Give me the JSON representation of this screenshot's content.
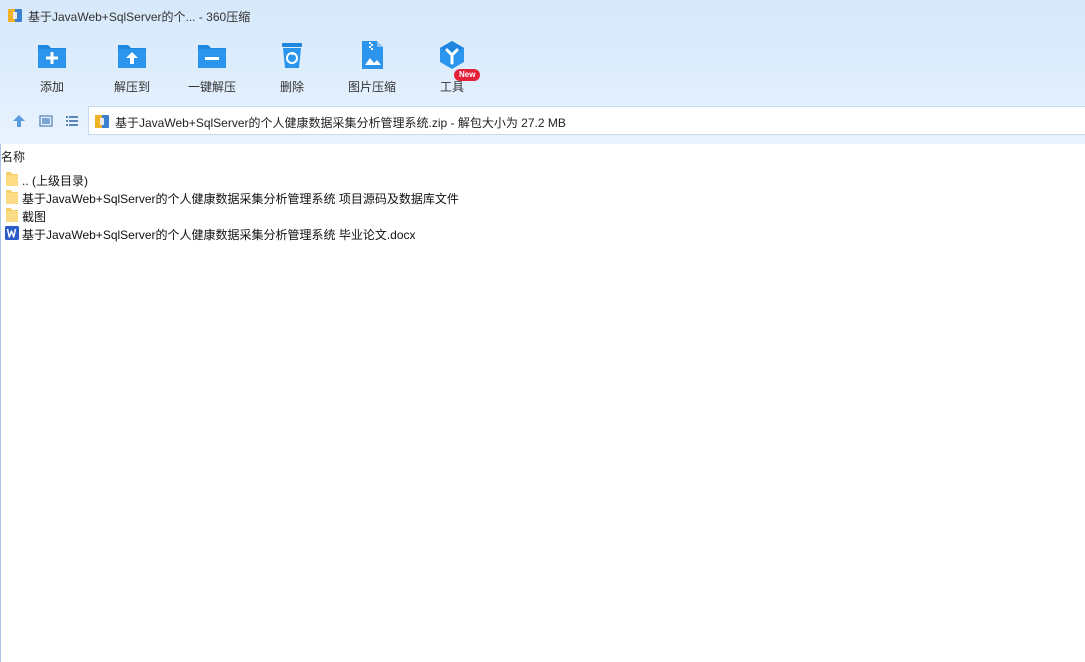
{
  "window": {
    "title": "基于JavaWeb+SqlServer的个... - 360压缩",
    "accent_color": "#2e8de4"
  },
  "toolbar": {
    "items": [
      {
        "label": "添加",
        "icon": "add-icon"
      },
      {
        "label": "解压到",
        "icon": "extract-to-icon"
      },
      {
        "label": "一键解压",
        "icon": "one-click-extract-icon"
      },
      {
        "label": "删除",
        "icon": "delete-icon"
      },
      {
        "label": "图片压缩",
        "icon": "image-compress-icon"
      },
      {
        "label": "工具",
        "icon": "tools-icon"
      }
    ],
    "new_badge": "New",
    "badge_color": "#e5213a"
  },
  "addressbar": {
    "path": "基于JavaWeb+SqlServer的个人健康数据采集分析管理系统.zip - 解包大小为 27.2 MB"
  },
  "filelist": {
    "column_header": "名称",
    "items": [
      {
        "name": ".. (上级目录)",
        "type": "folder"
      },
      {
        "name": "基于JavaWeb+SqlServer的个人健康数据采集分析管理系统 项目源码及数据库文件",
        "type": "folder"
      },
      {
        "name": "截图",
        "type": "folder"
      },
      {
        "name": "基于JavaWeb+SqlServer的个人健康数据采集分析管理系统 毕业论文.docx",
        "type": "word-document"
      }
    ]
  }
}
